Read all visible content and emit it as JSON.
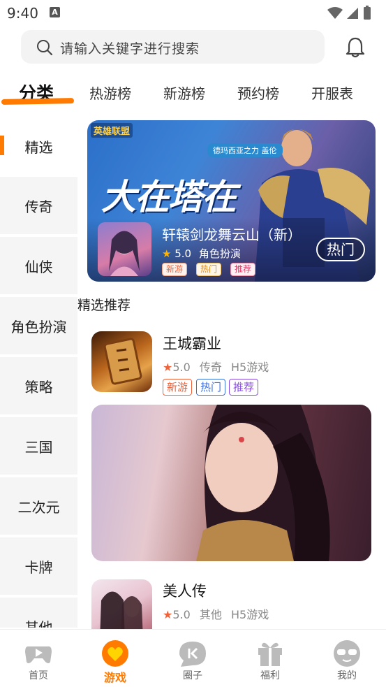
{
  "status_bar": {
    "time": "9:40",
    "app_badge": "A"
  },
  "search": {
    "placeholder": "请输入关键字进行搜索"
  },
  "top_tabs": [
    {
      "label": "分类",
      "active": true
    },
    {
      "label": "热游榜"
    },
    {
      "label": "新游榜"
    },
    {
      "label": "预约榜"
    },
    {
      "label": "开服表"
    }
  ],
  "sidebar": {
    "items": [
      {
        "label": "精选",
        "active": true
      },
      {
        "label": "传奇"
      },
      {
        "label": "仙侠"
      },
      {
        "label": "角色扮演"
      },
      {
        "label": "策略"
      },
      {
        "label": "三国"
      },
      {
        "label": "二次元"
      },
      {
        "label": "卡牌"
      },
      {
        "label": "其他"
      }
    ]
  },
  "banner": {
    "art_title": "大在塔在",
    "art_logo": "英雄联盟",
    "art_tag": "德玛西亚之力 盖伦",
    "game_name": "轩辕剑龙舞云山（新）",
    "rating": "5.0",
    "genre": "角色扮演",
    "hot_button": "热门",
    "badges": [
      "新游",
      "热门",
      "推荐"
    ]
  },
  "section": {
    "title": "精选推荐"
  },
  "games": [
    {
      "name": "王城霸业",
      "rating": "5.0",
      "genre": "传奇",
      "platform": "H5游戏",
      "tags": [
        "新游",
        "热门",
        "推荐"
      ]
    },
    {
      "name": "美人传",
      "rating": "5.0",
      "genre": "其他",
      "platform": "H5游戏"
    }
  ],
  "bottom_nav": [
    {
      "label": "首页",
      "icon": "gamepad-icon"
    },
    {
      "label": "游戏",
      "icon": "heart-bubble-icon",
      "active": true
    },
    {
      "label": "圈子",
      "icon": "chat-icon"
    },
    {
      "label": "福利",
      "icon": "gift-icon"
    },
    {
      "label": "我的",
      "icon": "sunglasses-face-icon"
    }
  ],
  "colors": {
    "accent": "#ff7a00",
    "tag_new": "#f0623a",
    "tag_hot": "#3a6fe0",
    "tag_rec": "#8a4be0"
  }
}
